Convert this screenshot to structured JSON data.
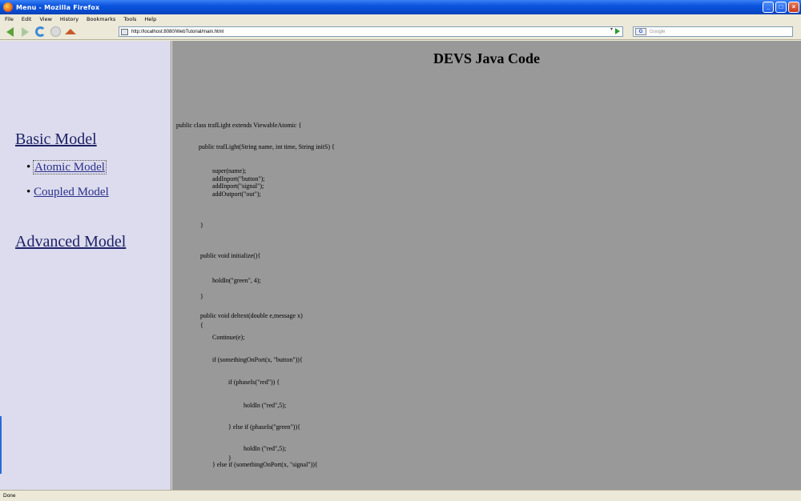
{
  "window": {
    "title": "Menu - Mozilla Firefox",
    "controls": {
      "minimize": "_",
      "maximize": "□",
      "close": "×"
    }
  },
  "menu": [
    "File",
    "Edit",
    "View",
    "History",
    "Bookmarks",
    "Tools",
    "Help"
  ],
  "toolbar": {
    "url": "http://localhost:8080/WebTutorial/main.html",
    "search_placeholder": "Google",
    "search_engine_icon": "G",
    "dropdown": "▾"
  },
  "sidebar": {
    "basic_model": "Basic Model",
    "atomic_model": "Atomic Model",
    "coupled_model": "Coupled Model",
    "advanced_model": "Advanced Model",
    "bullet": "•"
  },
  "main": {
    "heading": "DEVS Java Code",
    "code_lines": [
      "public class trafLight extends ViewableAtomic {",
      "public trafLight(String name, int time, String initS) {",
      "super(name);",
      "addInport(\"button\");",
      "addInport(\"signal\");",
      "addOutport(\"out\");",
      "}",
      "public void initialize(){",
      "holdIn(\"green\", 4);",
      "}",
      "public void deltext(double e,message x)",
      "{",
      "Continue(e);",
      "if (somethingOnPort(x, \"button\")){",
      "if (phaseIs(\"red\")) {",
      "holdIn (\"red\",5);",
      "} else if (phaseIs(\"green\")){",
      "holdIn (\"red\",5);",
      "}",
      "} else if (somethingOnPort(x, \"signal\")){"
    ]
  },
  "status": {
    "text": "Done"
  }
}
